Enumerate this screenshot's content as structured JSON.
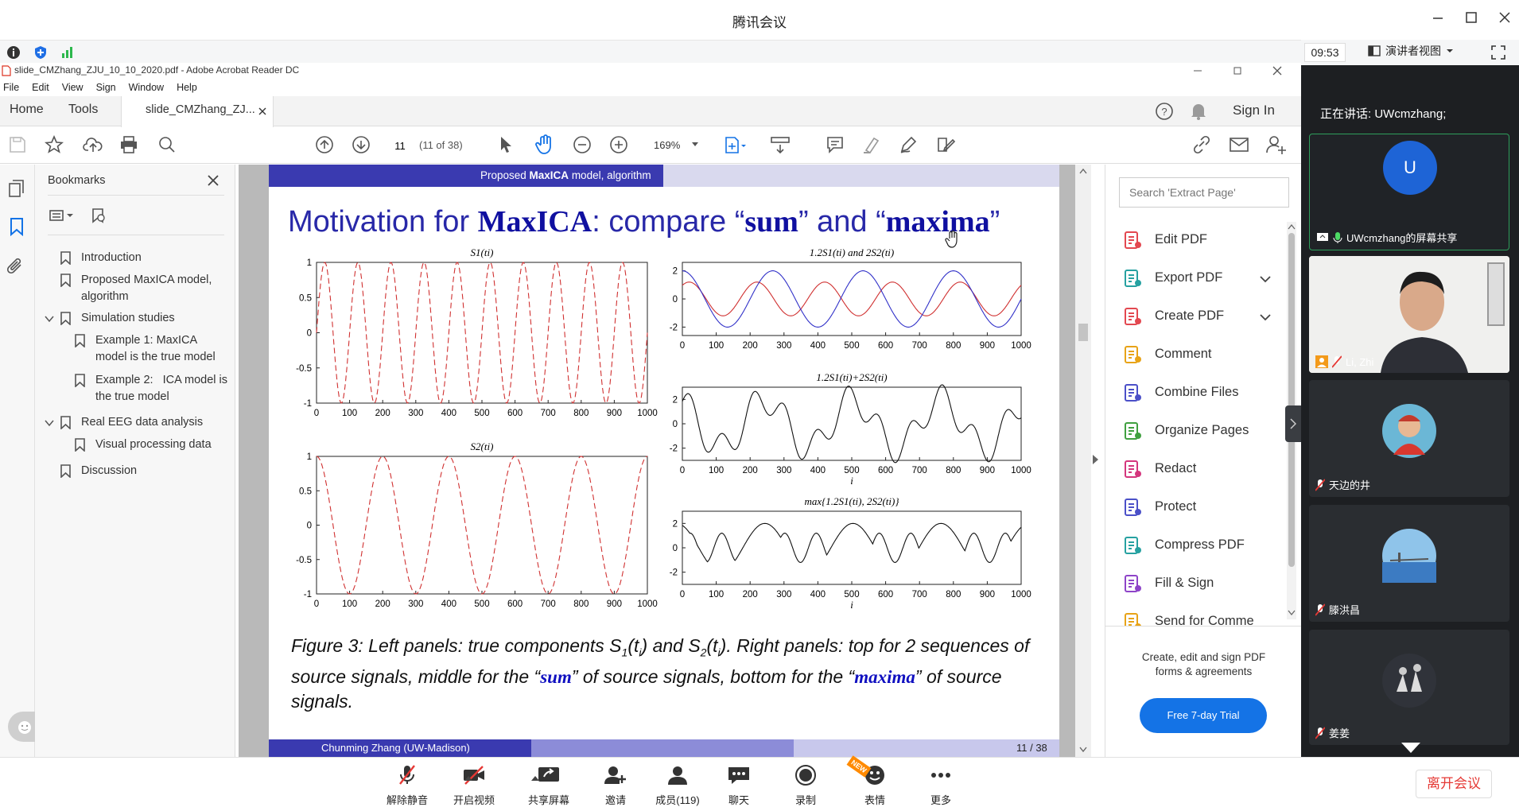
{
  "meeting": {
    "window_title": "腾讯会议",
    "clock": "09:53",
    "presenter_view_label": "演讲者视图",
    "speaking_label": "正在讲话: UWcmzhang;",
    "participants": [
      {
        "name": "UWcmzhang的屏幕共享",
        "avatar_letter": "U"
      },
      {
        "name": "Li, Zhi"
      },
      {
        "name": "天边的井"
      },
      {
        "name": "滕洪昌"
      },
      {
        "name": "姜姜"
      }
    ],
    "bottom_buttons": [
      {
        "label": "解除静音",
        "icon": "mic-muted-icon"
      },
      {
        "label": "开启视频",
        "icon": "video-off-icon"
      },
      {
        "label": "共享屏幕",
        "icon": "share-screen-icon"
      },
      {
        "label": "邀请",
        "icon": "invite-icon"
      },
      {
        "label": "成员(119)",
        "icon": "members-icon"
      },
      {
        "label": "聊天",
        "icon": "chat-icon"
      },
      {
        "label": "录制",
        "icon": "record-icon"
      },
      {
        "label": "表情",
        "icon": "emoji-icon"
      },
      {
        "label": "更多",
        "icon": "more-icon"
      }
    ],
    "new_badge": "NEW",
    "leave_button": "离开会议"
  },
  "acrobat": {
    "window_title": "slide_CMZhang_ZJU_10_10_2020.pdf - Adobe Acrobat Reader DC",
    "menu": [
      "File",
      "Edit",
      "View",
      "Sign",
      "Window",
      "Help"
    ],
    "tabs": {
      "home": "Home",
      "tools": "Tools",
      "doc": "slide_CMZhang_ZJ..."
    },
    "sign_in": "Sign In",
    "page_current": "11",
    "page_of": "(11 of 38)",
    "zoom": "169%",
    "bookmarks_title": "Bookmarks",
    "bookmarks": [
      {
        "label": "Introduction",
        "level": 0
      },
      {
        "label": "Proposed MaxICA model,",
        "label2": "algorithm",
        "level": 0
      },
      {
        "label": "Simulation studies",
        "level": 0,
        "expanded": true
      },
      {
        "label": "Example 1: MaxICA",
        "label2": "model is the true model",
        "level": 1
      },
      {
        "label": "Example 2:   ICA model is",
        "label2": "the true model",
        "level": 1
      },
      {
        "label": "Real EEG data analysis",
        "level": 0,
        "expanded": true
      },
      {
        "label": "Visual processing data",
        "level": 1
      },
      {
        "label": "Discussion",
        "level": 0
      }
    ],
    "search_placeholder": "Search 'Extract Page'",
    "tools": [
      {
        "label": "Edit PDF",
        "icon": "edit-pdf-icon",
        "color": "#e34850"
      },
      {
        "label": "Export PDF",
        "icon": "export-pdf-icon",
        "color": "#26a1a1",
        "expand": true
      },
      {
        "label": "Create PDF",
        "icon": "create-pdf-icon",
        "color": "#e34850",
        "expand": true
      },
      {
        "label": "Comment",
        "icon": "comment-icon",
        "color": "#e8a317"
      },
      {
        "label": "Combine Files",
        "icon": "combine-files-icon",
        "color": "#4b50c8"
      },
      {
        "label": "Organize Pages",
        "icon": "organize-pages-icon",
        "color": "#40a040"
      },
      {
        "label": "Redact",
        "icon": "redact-icon",
        "color": "#d4367d"
      },
      {
        "label": "Protect",
        "icon": "protect-icon",
        "color": "#4b50c8"
      },
      {
        "label": "Compress PDF",
        "icon": "compress-pdf-icon",
        "color": "#26a1a1"
      },
      {
        "label": "Fill & Sign",
        "icon": "fill-sign-icon",
        "color": "#8e44c8"
      },
      {
        "label": "Send for Comme",
        "icon": "send-comment-icon",
        "color": "#e8a317"
      }
    ],
    "promo_text_1": "Create, edit and sign PDF",
    "promo_text_2": "forms & agreements",
    "promo_button": "Free 7-day Trial"
  },
  "slide": {
    "banner_text_pre": "Proposed ",
    "banner_text_bold": "MaxICA",
    "banner_text_post": " model, algorithm",
    "title_pre": "Motivation for ",
    "title_bold1": "MaxICA",
    "title_mid": ": compare “",
    "title_bold2": "sum",
    "title_mid2": "” and “",
    "title_bold3": "maxima",
    "title_end": "”",
    "caption_a": "Figure 3:  Left panels: true components S",
    "caption_b": "(t",
    "caption_c": ") and S",
    "caption_d": "(t",
    "caption_e": "). Right panels: top for 2 sequences of source signals, middle for the “",
    "caption_sum": "sum",
    "caption_f": "” of source signals, bottom for the “",
    "caption_max": "maxima",
    "caption_g": "” of source signals.",
    "footer_author": "Chunming Zhang  (UW-Madison)",
    "footer_page": "11 / 38"
  },
  "chart_data": [
    {
      "type": "line",
      "title": "S1(ti)",
      "x": [
        0,
        1000
      ],
      "xticks": [
        0,
        100,
        200,
        300,
        400,
        500,
        600,
        700,
        800,
        900,
        1000
      ],
      "yticks": [
        1,
        0.5,
        0,
        -0.5,
        -1
      ],
      "ylim": [
        -1,
        1
      ],
      "series": [
        {
          "style": "dashed",
          "color": "#d03030",
          "period": 100
        }
      ]
    },
    {
      "type": "line",
      "title": "S2(ti)",
      "xticks": [
        0,
        100,
        200,
        300,
        400,
        500,
        600,
        700,
        800,
        900,
        1000
      ],
      "yticks": [
        1,
        0.5,
        0,
        -0.5,
        -1
      ],
      "ylim": [
        -1,
        1
      ],
      "series": [
        {
          "style": "dashed",
          "color": "#d03030",
          "period": 200
        }
      ]
    },
    {
      "type": "line",
      "title": "1.2S1(ti) and 2S2(ti)",
      "xticks": [
        0,
        100,
        200,
        300,
        400,
        500,
        600,
        700,
        800,
        900,
        1000
      ],
      "yticks": [
        2,
        0,
        -2
      ],
      "ylim": [
        -2.6,
        2.6
      ],
      "series": [
        {
          "color": "#d03030"
        },
        {
          "color": "#3030c8"
        }
      ]
    },
    {
      "type": "line",
      "title": "1.2S1(ti)+2S2(ti)",
      "xlabel": "i",
      "xticks": [
        0,
        100,
        200,
        300,
        400,
        500,
        600,
        700,
        800,
        900,
        1000
      ],
      "yticks": [
        2,
        0,
        -2
      ],
      "ylim": [
        -3,
        3
      ],
      "series": [
        {
          "color": "#111"
        }
      ]
    },
    {
      "type": "line",
      "title": "max{1.2S1(ti), 2S2(ti)}",
      "xlabel": "i",
      "xticks": [
        0,
        100,
        200,
        300,
        400,
        500,
        600,
        700,
        800,
        900,
        1000
      ],
      "yticks": [
        2,
        0,
        -2
      ],
      "ylim": [
        -3,
        3
      ],
      "series": [
        {
          "color": "#111"
        }
      ]
    }
  ]
}
